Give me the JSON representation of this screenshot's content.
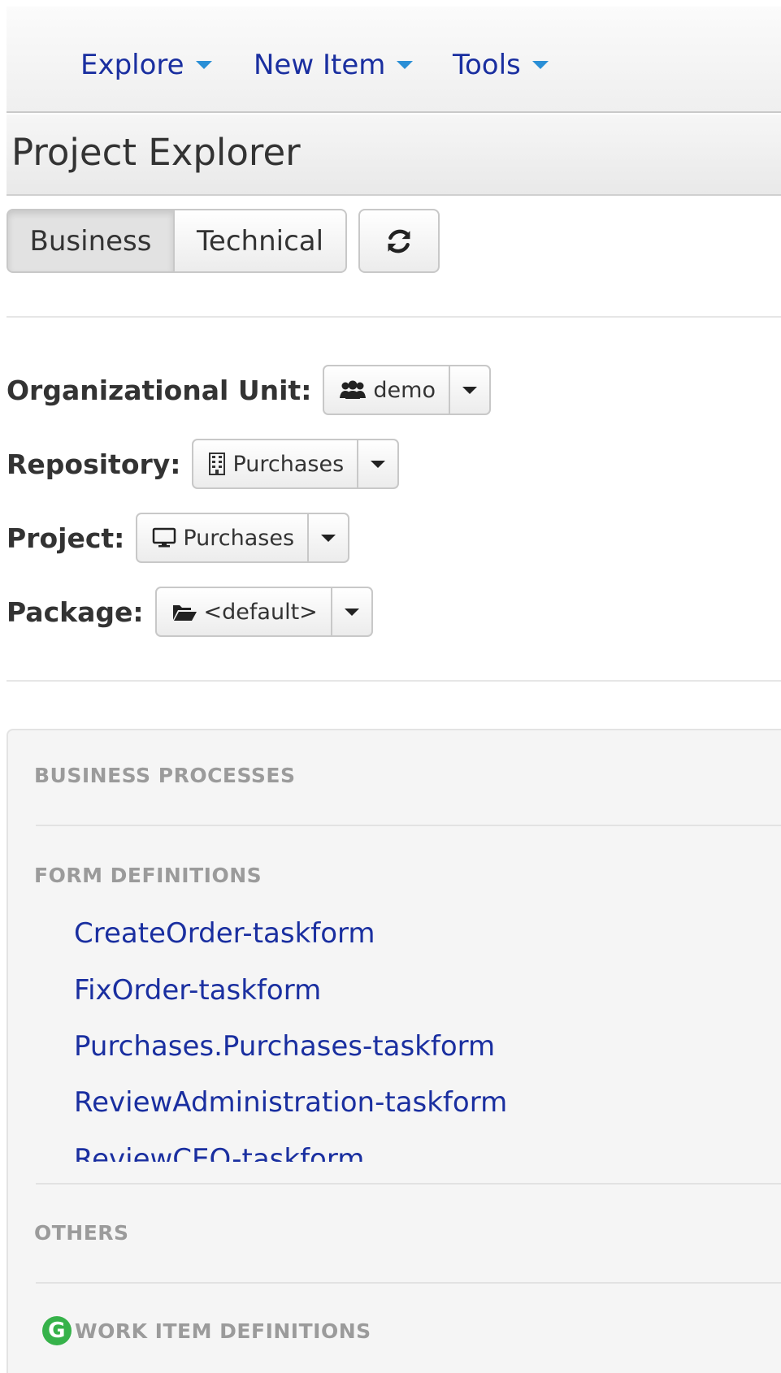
{
  "nav": {
    "items": [
      {
        "label": "Explore"
      },
      {
        "label": "New Item"
      },
      {
        "label": "Tools"
      }
    ]
  },
  "panel": {
    "title": "Project Explorer"
  },
  "view_toggle": {
    "business_label": "Business",
    "technical_label": "Technical",
    "active": "Business",
    "refresh_icon": "refresh-icon"
  },
  "selectors": {
    "org_unit": {
      "label": "Organizational Unit:",
      "value": "demo",
      "icon": "users-icon"
    },
    "repository": {
      "label": "Repository:",
      "value": "Purchases",
      "icon": "building-icon"
    },
    "project": {
      "label": "Project:",
      "value": "Purchases",
      "icon": "monitor-icon"
    },
    "package": {
      "label": "Package:",
      "value": "<default>",
      "icon": "folder-open-icon"
    }
  },
  "explorer": {
    "business_processes_title": "BUSINESS PROCESSES",
    "form_definitions_title": "FORM DEFINITIONS",
    "form_definitions": [
      "CreateOrder-taskform",
      "FixOrder-taskform",
      "Purchases.Purchases-taskform",
      "ReviewAdministration-taskform",
      "ReviewCEO-taskform"
    ],
    "others_title": "OTHERS",
    "work_item_definitions_title": "WORK ITEM DEFINITIONS",
    "work_item_icon_letter": "G"
  },
  "colors": {
    "link": "#1a2fa0",
    "nav_caret": "#2a8fd6",
    "section_title": "#9b9b9b",
    "well_bg": "#f5f5f5",
    "work_item_icon": "#36b24a"
  }
}
